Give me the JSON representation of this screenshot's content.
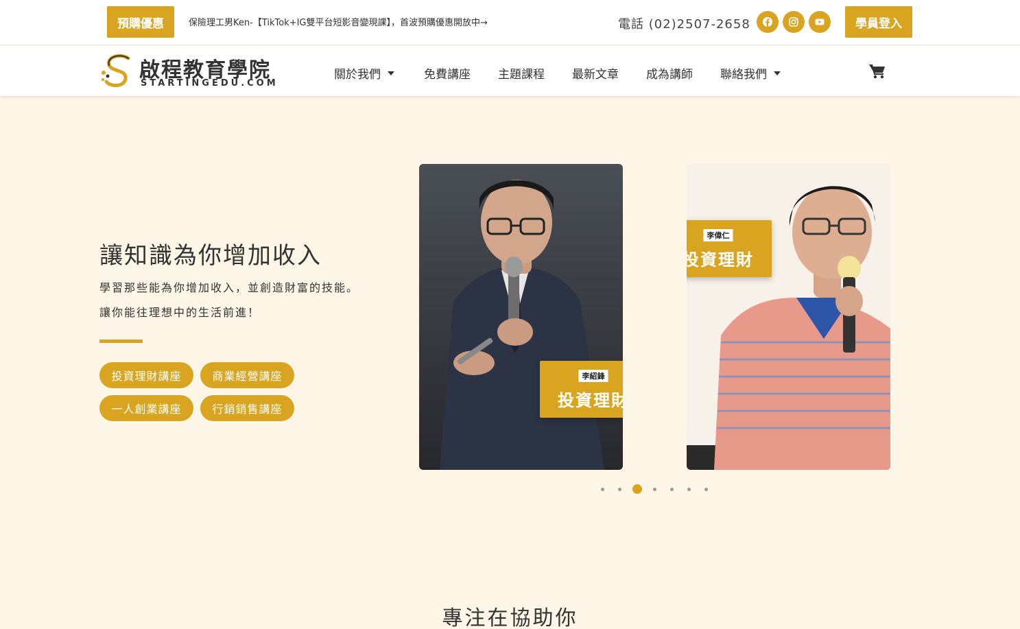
{
  "topbar": {
    "promo_label": "預購優惠",
    "promo_text": "保險理工男Ken-【TikTok+IG雙平台短影音變現課】，首波預購優惠開放中→",
    "phone": "電話 (02)2507-2658",
    "login_label": "學員登入",
    "social": [
      "facebook-icon",
      "instagram-icon",
      "youtube-icon"
    ],
    "accent": "#d9a520"
  },
  "nav": {
    "logo_name": "啟程教育學院",
    "logo_sub": "STARTINGEDU.COM",
    "items": [
      {
        "label": "關於我們",
        "dropdown": true
      },
      {
        "label": "免費講座",
        "dropdown": false
      },
      {
        "label": "主題課程",
        "dropdown": false
      },
      {
        "label": "最新文章",
        "dropdown": false
      },
      {
        "label": "成為講師",
        "dropdown": false
      },
      {
        "label": "聯絡我們",
        "dropdown": true
      }
    ],
    "cart_icon": "cart-icon"
  },
  "hero": {
    "title": "讓知識為你增加收入",
    "line1": "學習那些能為你增加收入，並創造財富的技能。",
    "line2": "讓你能往理想中的生活前進！",
    "pills": [
      "投資理財講座",
      "商業經營講座",
      "一人創業講座",
      "行銷銷售講座"
    ]
  },
  "slides": [
    {
      "name": "李紹鋒",
      "topic": "投資理財"
    },
    {
      "name": "李偉仁",
      "topic": "投資理財"
    }
  ],
  "carousel": {
    "total": 7,
    "active": 3
  },
  "section": {
    "title": "專注在協助你"
  }
}
